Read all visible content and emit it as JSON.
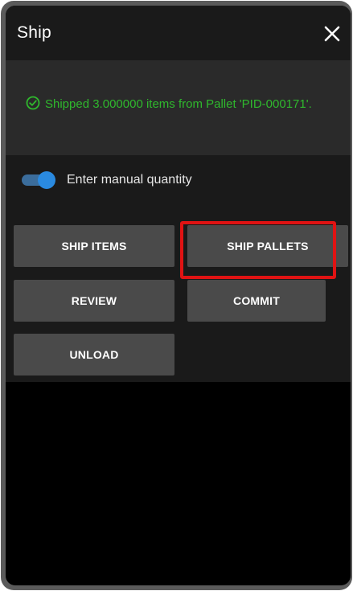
{
  "header": {
    "title": "Ship"
  },
  "status": {
    "message": "Shipped 3.000000 items from Pallet 'PID-000171'."
  },
  "manual_quantity": {
    "label": "Enter manual quantity",
    "enabled": true
  },
  "actions": {
    "ship_items": "SHIP ITEMS",
    "ship_pallets": "SHIP PALLETS",
    "review": "REVIEW",
    "commit": "COMMIT",
    "unload": "UNLOAD"
  },
  "colors": {
    "success_text": "#2fb82d",
    "toggle_on": "#2a8ae0",
    "highlight": "#e01313"
  }
}
